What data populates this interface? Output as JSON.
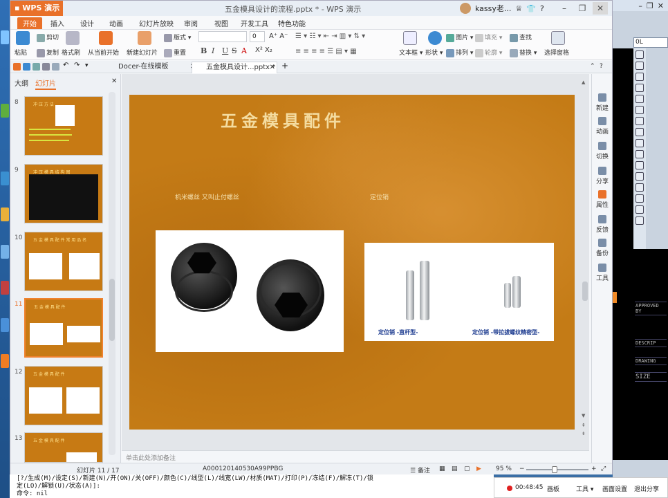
{
  "app": {
    "name": "WPS 演示",
    "doc_title": "五金模具设计的流程.pptx * - WPS 演示",
    "user_name": "kassy老..."
  },
  "ribbon_tabs": [
    "开始",
    "插入",
    "设计",
    "动画",
    "幻灯片放映",
    "审阅",
    "视图",
    "开发工具",
    "特色功能"
  ],
  "ribbon": {
    "paste": "粘贴",
    "cut": "剪切",
    "copy": "复制",
    "format_painter": "格式刷",
    "from_current": "从当前开始",
    "new_slide": "新建幻灯片",
    "layout": "版式",
    "reset": "重置",
    "font_size": "0",
    "textbox": "文本框",
    "shape": "形状",
    "picture": "图片",
    "fill": "填充",
    "arrange": "排列",
    "outline": "轮廓",
    "find": "查找",
    "replace": "替换",
    "select_pane": "选择窗格",
    "fmt_bold": "B",
    "fmt_italic": "I",
    "fmt_underline": "U",
    "fmt_strike": "S",
    "fmt_color": "A"
  },
  "doc_tabs": {
    "docer": "Docer-在线模板",
    "current": "五金模具设计...pptx *"
  },
  "left_pane": {
    "tab_outline": "大纲",
    "tab_slides": "幻灯片",
    "thumbs": [
      {
        "num": "8",
        "title": "冲 压 方 法"
      },
      {
        "num": "9",
        "title": "冲 压 模 具 结 构 图"
      },
      {
        "num": "10",
        "title": "五 金 模 具 配 件 常 用 品 名"
      },
      {
        "num": "11",
        "title": "五 金 模 具 配 件"
      },
      {
        "num": "12",
        "title": "五 金 模 具 配 件"
      },
      {
        "num": "13",
        "title": "五 金 模 具 配 件"
      }
    ]
  },
  "slide": {
    "title": "五金模具配件",
    "caption_left": "机米螺丝 又叫止付螺丝",
    "caption_right": "定位销",
    "pin_caption_1": "定位销 -直杆型-",
    "pin_caption_2": "定位销 -带拉拔螺纹精密型-"
  },
  "notes_placeholder": "单击此处添加备注",
  "task_pane": [
    "新建",
    "动画",
    "切换",
    "分享",
    "属性",
    "反馈",
    "备份",
    "工具"
  ],
  "status": {
    "slide_counter": "幻灯片 11 / 17",
    "code": "A000120140530A99PPBG",
    "notes": "备注",
    "zoom": "95 %",
    "zoom_fraction": 0.45
  },
  "cad": {
    "combo_value": "0L",
    "labels": [
      "APPROVED BY",
      "DESCRIP",
      "DRAWING",
      "SIZE"
    ]
  },
  "command_line": {
    "line1": "[?/生成(M)/设定(S)/新建(N)/开(ON)/关(OFF)/颜色(C)/线型(L)/线宽(LW)/材质(MAT)/打印(P)/冻结(F)/解冻(T)/锁",
    "line2": "定(LO)/解锁(U)/状态(A)]:",
    "line3": "命令: nil"
  },
  "recording": {
    "time": "00:48:45",
    "panel": "画板",
    "tools": "工具",
    "settings": "画面设置",
    "exit": "退出分享"
  }
}
